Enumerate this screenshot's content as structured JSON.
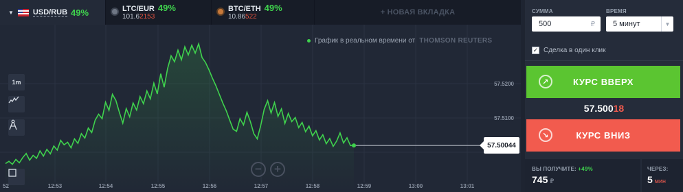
{
  "tabs": [
    {
      "pair": "USD/RUB",
      "percent": "49%"
    },
    {
      "pair": "LTC/EUR",
      "percent": "49%",
      "price_main": "101.6",
      "price_hl": "2153"
    },
    {
      "pair": "BTC/ETH",
      "percent": "49%",
      "price_main": "10.86",
      "price_hl": "522"
    }
  ],
  "new_tab_label": "+ НОВАЯ ВКЛАДКА",
  "chart": {
    "realtime_text": "График в реальном времени от",
    "provider": "THOMSON REUTERS",
    "timeframe": "1m",
    "current_price": "57.50044",
    "price_ticks": [
      "57.5200",
      "57.5100"
    ],
    "time_ticks": [
      "12:53",
      "12:54",
      "12:55",
      "12:56",
      "12:57",
      "12:58",
      "12:59",
      "13:00",
      "13:01"
    ],
    "edge_label": "52",
    "zoom_out": "−",
    "zoom_in": "+",
    "colors": {
      "line": "#3fd24d",
      "up": "#5bc531",
      "down": "#f25b4e"
    }
  },
  "chart_data": {
    "type": "line",
    "ylim": [
      57.4935,
      57.5305
    ],
    "xlim": [
      0,
      101
    ],
    "x": [
      0,
      1,
      2,
      3,
      4,
      5,
      6,
      7,
      8,
      9,
      10,
      11,
      12,
      13,
      14,
      15,
      16,
      17,
      18,
      19,
      20,
      21,
      22,
      23,
      24,
      25,
      26,
      27,
      28,
      29,
      30,
      31,
      32,
      33,
      34,
      35,
      36,
      37,
      38,
      39,
      40,
      41,
      42,
      43,
      44,
      45,
      46,
      47,
      48,
      49,
      50,
      51,
      52,
      53,
      54,
      55,
      56,
      57,
      58,
      59,
      60,
      61,
      62,
      63,
      64,
      65,
      66,
      67,
      68,
      69,
      70,
      71,
      72,
      73,
      74,
      75,
      76,
      77,
      78,
      79,
      80,
      81,
      82,
      83,
      84,
      85,
      86,
      87,
      88,
      89,
      90,
      91,
      92,
      93,
      94,
      95,
      96,
      97,
      98,
      99,
      100,
      101
    ],
    "y": [
      57.4956,
      57.4962,
      57.4954,
      57.4967,
      57.4958,
      57.4972,
      57.4983,
      57.4965,
      57.4978,
      57.497,
      57.499,
      57.4976,
      57.4994,
      57.4982,
      57.5003,
      57.4992,
      57.5018,
      57.5006,
      57.5013,
      57.4998,
      57.5022,
      57.501,
      57.5036,
      57.5024,
      57.5051,
      57.5039,
      57.5072,
      57.5088,
      57.5076,
      57.512,
      57.5098,
      57.5141,
      57.5125,
      57.5093,
      57.5064,
      57.5103,
      57.5081,
      57.5118,
      57.5099,
      57.5135,
      57.5116,
      57.515,
      57.5129,
      57.5171,
      57.5142,
      57.5196,
      57.516,
      57.521,
      57.5244,
      57.5228,
      57.5259,
      57.5233,
      57.5268,
      57.5246,
      57.5272,
      57.5251,
      57.5276,
      57.5239,
      57.5226,
      57.5206,
      57.5184,
      57.5164,
      57.5141,
      57.5118,
      57.5097,
      57.5072,
      57.5048,
      57.5042,
      57.5076,
      57.5059,
      57.5093,
      57.5068,
      57.5036,
      57.5022,
      57.5058,
      57.5101,
      57.5124,
      57.5091,
      57.5119,
      57.5082,
      57.5102,
      57.5063,
      57.509,
      57.5068,
      57.5079,
      57.5052,
      57.5066,
      57.5041,
      57.5056,
      57.503,
      57.5044,
      57.5019,
      57.5033,
      57.5009,
      57.5023,
      57.5002,
      57.5016,
      57.5038,
      57.5011,
      57.5025,
      57.5004,
      57.50044
    ]
  },
  "panel": {
    "amount_label": "СУММА",
    "amount_value": "500",
    "amount_suffix": "₽",
    "time_label": "ВРЕМЯ",
    "time_value": "5 минут",
    "oneclick_label": "Сделка в один клик",
    "up_label": "КУРС ВВЕРХ",
    "down_label": "КУРС ВНИЗ",
    "rate_main": "57.500",
    "rate_hl": "18",
    "receive_label": "ВЫ ПОЛУЧИТЕ:",
    "receive_pct": "+49%",
    "receive_value": "745",
    "receive_unit": "₽",
    "through_label": "ЧЕРЕЗ:",
    "through_value": "5",
    "through_unit": "мин"
  }
}
